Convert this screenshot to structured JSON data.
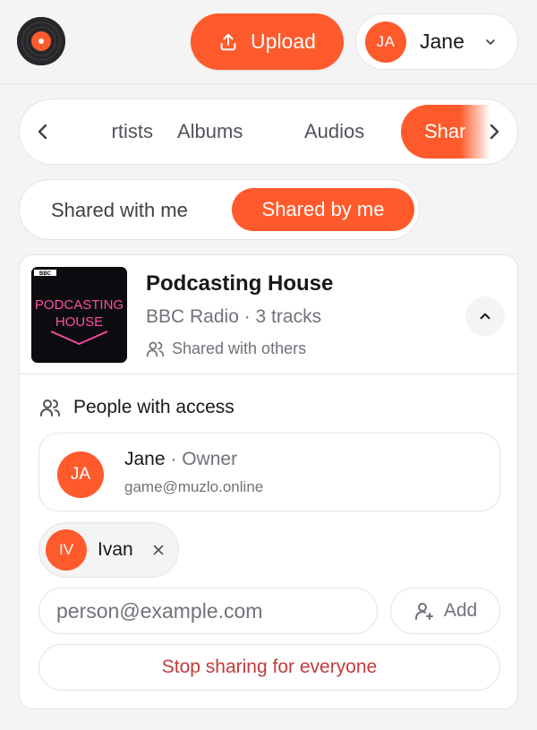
{
  "header": {
    "upload_label": "Upload",
    "user": {
      "initials": "JA",
      "name": "Jane"
    }
  },
  "tabs": {
    "items": [
      {
        "label": "rtists"
      },
      {
        "label": "Albums"
      },
      {
        "label": "Audios"
      },
      {
        "label": "Shar",
        "active": true
      }
    ]
  },
  "segment": {
    "options": [
      "Shared with me",
      "Shared by me"
    ],
    "selected": "Shared by me"
  },
  "podcast": {
    "cover_text": [
      "PODCASTING",
      "HOUSE"
    ],
    "cover_badge": "BBC",
    "title": "Podcasting House",
    "subtitle": "BBC Radio · 3 tracks",
    "shared_status": "Shared with others"
  },
  "access": {
    "heading": "People with access",
    "owner": {
      "initials": "JA",
      "name": "Jane",
      "role": "· Owner",
      "email": "game@muzlo.online"
    },
    "shared_people": [
      {
        "initials": "IV",
        "name": "Ivan"
      }
    ],
    "email_placeholder": "person@example.com",
    "add_label": "Add",
    "stop_label": "Stop sharing for everyone"
  },
  "colors": {
    "accent": "#ff5a2c",
    "danger": "#c23a3a",
    "muted": "#71717a"
  },
  "icons": [
    "vinyl-logo-icon",
    "upload-icon",
    "chevron-down-icon",
    "chevron-left-icon",
    "chevron-right-icon",
    "users-icon",
    "chevron-up-icon",
    "close-icon",
    "user-plus-icon"
  ]
}
